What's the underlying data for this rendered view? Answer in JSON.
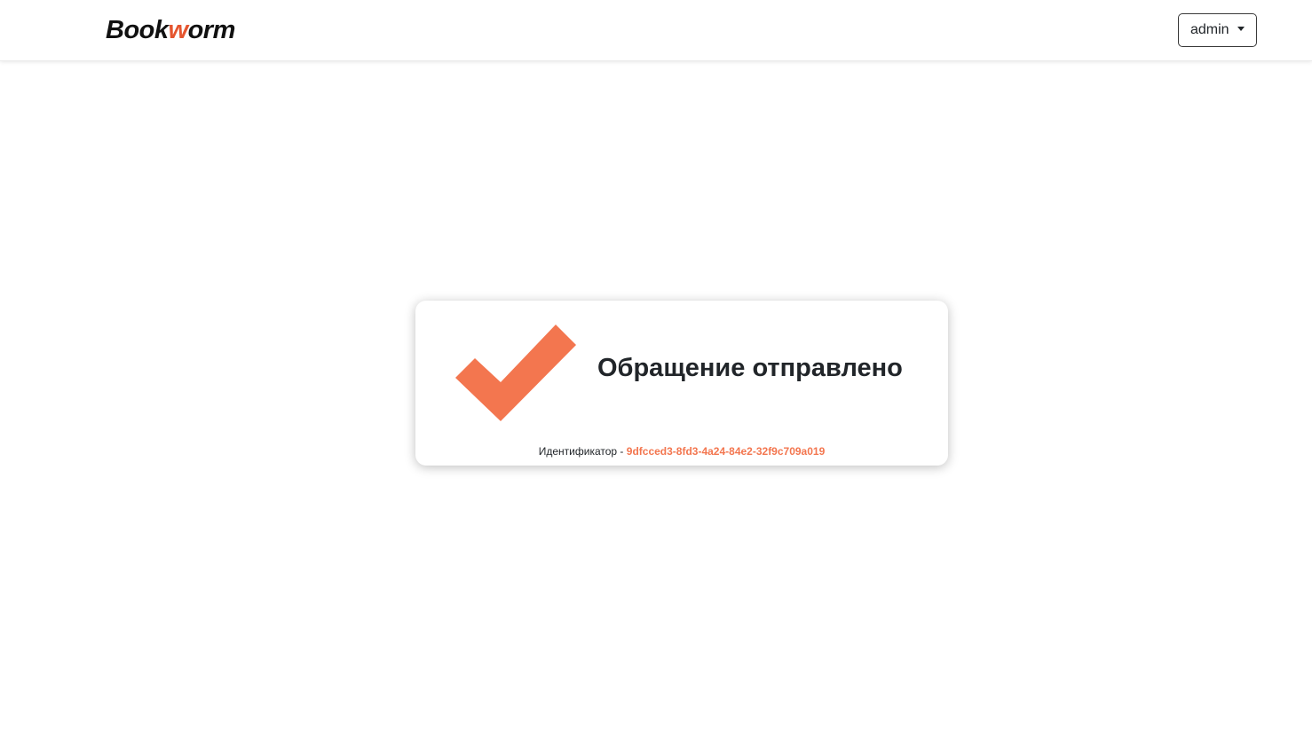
{
  "navbar": {
    "brand_start": "Book",
    "brand_accent": "w",
    "brand_end": "orm",
    "user_label": "admin"
  },
  "result": {
    "title": "Обращение отправлено",
    "id_label": "Идентификатор -",
    "id_value": "9dfcced3-8fd3-4a24-84e2-32f9c709a019"
  },
  "icons": {
    "success": "checkmark-icon",
    "dropdown": "caret-down-icon"
  },
  "colors": {
    "accent": "#f3764f",
    "brand_accent": "#e5552f"
  }
}
